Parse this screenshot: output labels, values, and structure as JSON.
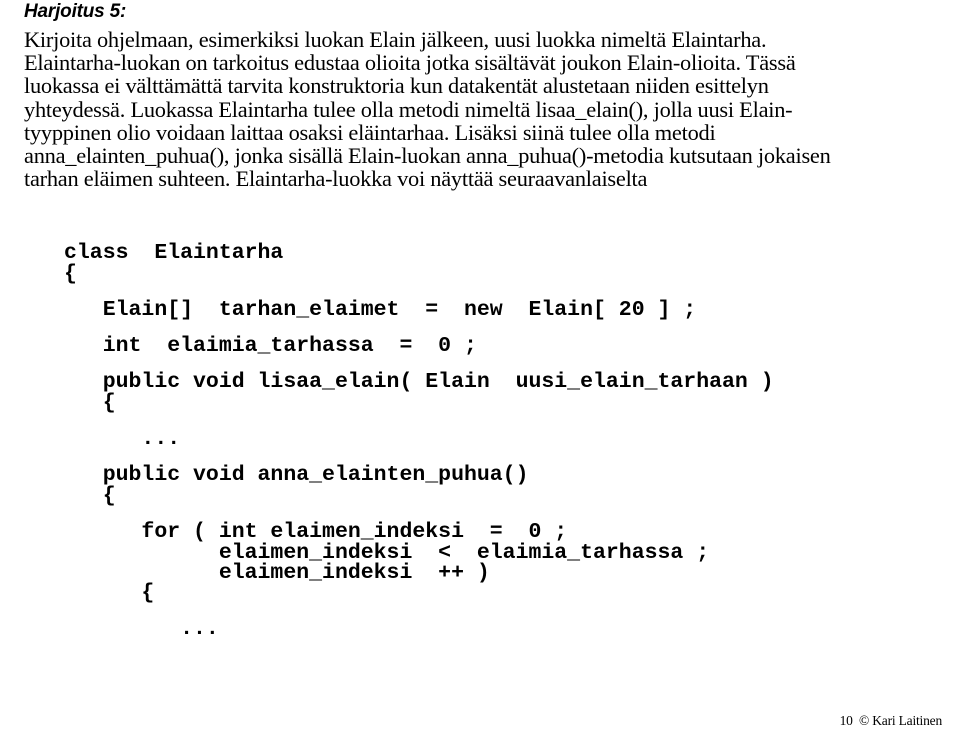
{
  "document": {
    "title": "Harjoitus 5:",
    "paragraph_lines": [
      "Kirjoita ohjelmaan, esimerkiksi luokan Elain jälkeen, uusi luokka nimeltä Elaintarha.",
      "Elaintarha-luokan on tarkoitus edustaa olioita jotka sisältävät joukon Elain-olioita. Tässä",
      "luokassa ei välttämättä tarvita konstruktoria kun datakentät alustetaan niiden esittelyn",
      "yhteydessä. Luokassa Elaintarha tulee olla metodi nimeltä lisaa_elain(), jolla uusi Elain-",
      "tyyppinen olio voidaan laittaa osaksi eläintarhaa. Lisäksi siinä tulee olla metodi",
      "anna_elainten_puhua(), jonka sisällä Elain-luokan anna_puhua()-metodia kutsutaan jokaisen",
      "tarhan eläimen suhteen. Elaintarha-luokka voi näyttää seuraavanlaiselta"
    ],
    "code_lines": [
      "class  Elaintarha",
      "{",
      "   Elain[]  tarhan_elaimet  =  new  Elain[ 20 ] ;",
      "   int  elaimia_tarhassa  =  0 ;",
      "   public void lisaa_elain( Elain  uusi_elain_tarhaan )",
      "   {",
      "      ...",
      "   public void anna_elainten_puhua()",
      "   {",
      "      for ( int elaimen_indeksi  =  0 ;",
      "            elaimen_indeksi  <  elaimia_tarhassa ;",
      "            elaimen_indeksi  ++ )",
      "      {",
      "         ..."
    ],
    "footer": "10  © Kari Laitinen"
  }
}
